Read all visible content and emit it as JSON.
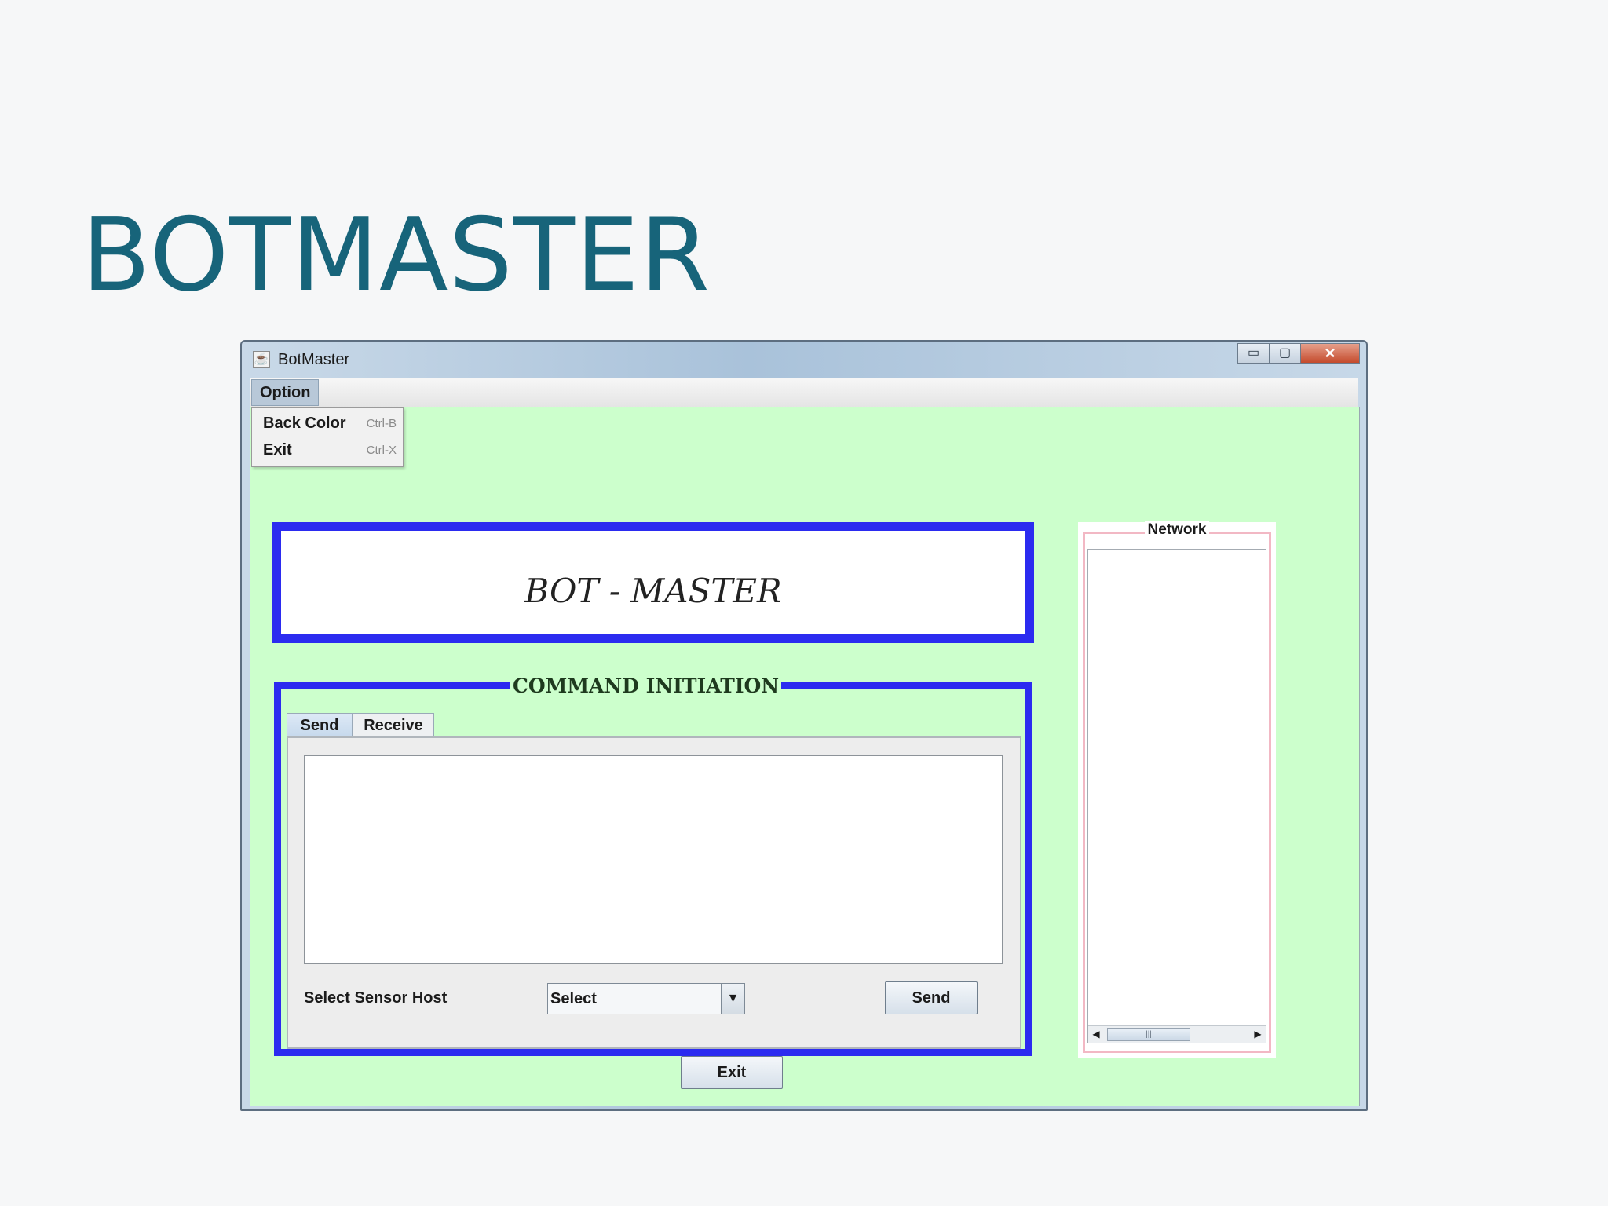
{
  "slide": {
    "title": "BOTMASTER"
  },
  "window": {
    "title": "BotMaster",
    "controls": {
      "minimize": "▭",
      "maximize": "▢",
      "close": "✕"
    }
  },
  "menu": {
    "option_label": "Option",
    "items": [
      {
        "label": "Back Color",
        "accelerator": "Ctrl-B"
      },
      {
        "label": "Exit",
        "accelerator": "Ctrl-X"
      }
    ]
  },
  "banner": {
    "text": "BOT - MASTER"
  },
  "command": {
    "title": "COMMAND INITIATION",
    "tabs": [
      {
        "label": "Send"
      },
      {
        "label": "Receive"
      }
    ],
    "sensor_label": "Select Sensor Host",
    "sensor_select": "Select",
    "send_button": "Send"
  },
  "network": {
    "title": "Network"
  },
  "footer": {
    "exit_button": "Exit"
  },
  "icons": {
    "app": "java-icon",
    "combo_arrow": "chevron-down-icon",
    "scroll_left": "arrow-left-icon",
    "scroll_right": "arrow-right-icon"
  },
  "colors": {
    "background": "#ccffcc",
    "border_blue": "#2b2bf0",
    "network_border": "#f2b8c4",
    "title_teal": "#17647a"
  }
}
